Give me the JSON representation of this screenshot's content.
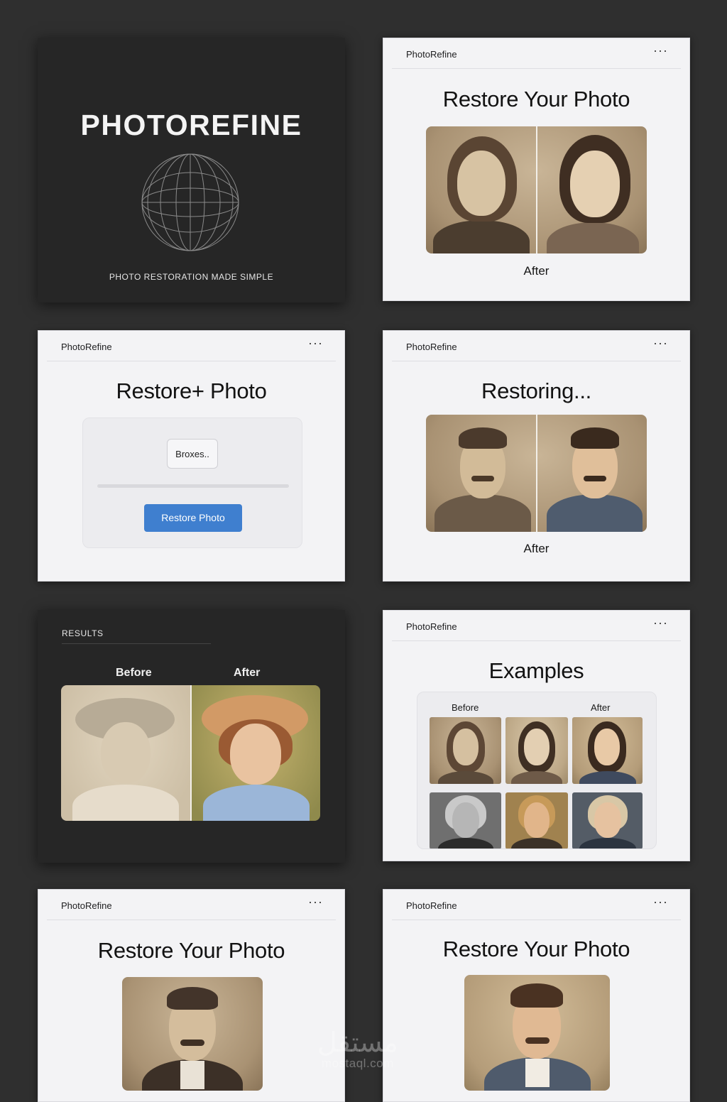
{
  "hero": {
    "title": "PHOTOREFINE",
    "tagline": "PHOTO RESTORATION MADE SIMPLE",
    "icon": "globe-wireframe-icon"
  },
  "screens": {
    "restore1": {
      "brand": "PhotoRefine",
      "menu": "···",
      "title": "Restore Your Photo",
      "caption": "After"
    },
    "upload": {
      "brand": "PhotoRefine",
      "menu": "···",
      "title": "Restore+ Photo",
      "browse_label": "Broxes..",
      "button_label": "Restore Photo"
    },
    "restoring": {
      "brand": "PhotoRefine",
      "menu": "···",
      "title": "Restoring...",
      "caption": "After"
    },
    "results": {
      "label": "RESULTS",
      "before": "Before",
      "after": "After"
    },
    "examples": {
      "brand": "PhotoRefine",
      "menu": "···",
      "title": "Examples",
      "before": "Before",
      "after": "After"
    },
    "restore2": {
      "brand": "PhotoRefine",
      "menu": "···",
      "title": "Restore Your Photo"
    },
    "restore3": {
      "brand": "PhotoRefine",
      "menu": "···",
      "title": "Restore Your Photo"
    }
  },
  "watermark": {
    "glyph": "مستقل",
    "text": "mostaql.com"
  },
  "colors": {
    "page_bg": "#2f2f2f",
    "accent_button": "#3f7fcf",
    "card_light": "#f3f3f5",
    "card_dark": "#262626"
  }
}
